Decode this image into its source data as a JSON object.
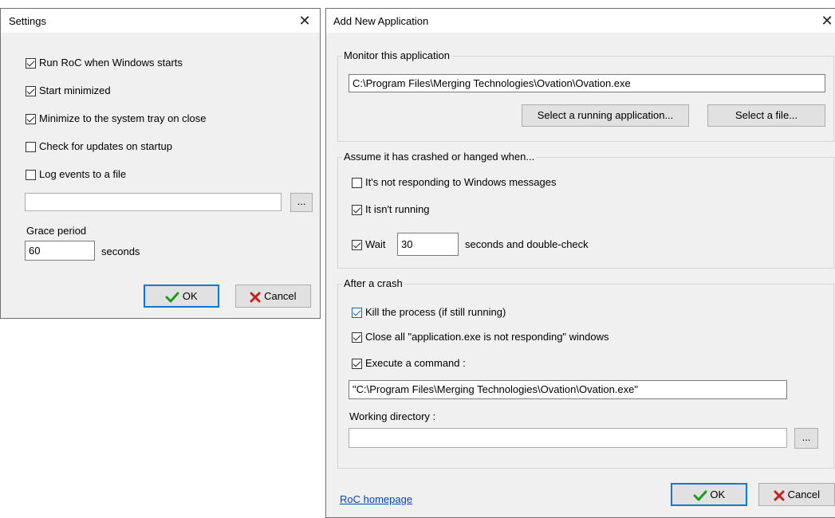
{
  "settings": {
    "title": "Settings",
    "options": [
      {
        "label": "Run RoC when Windows starts",
        "checked": true
      },
      {
        "label": "Start minimized",
        "checked": true
      },
      {
        "label": "Minimize to the system tray on close",
        "checked": true
      },
      {
        "label": "Check for updates on startup",
        "checked": false
      },
      {
        "label": "Log events to a file",
        "checked": false
      }
    ],
    "log_path": "",
    "browse_label": "...",
    "grace_label": "Grace period",
    "grace_value": "60",
    "grace_unit": "seconds",
    "ok_label": "OK",
    "cancel_label": "Cancel"
  },
  "add_app": {
    "title": "Add New Application",
    "monitor": {
      "group_label": "Monitor this application",
      "path": "C:\\Program Files\\Merging Technologies\\Ovation\\Ovation.exe",
      "select_running_label": "Select a running application...",
      "select_file_label": "Select a file..."
    },
    "crash": {
      "group_label": "Assume it has crashed or hanged when...",
      "not_responding_label": "It's not responding to Windows messages",
      "not_responding_checked": false,
      "not_running_label": "It isn't running",
      "not_running_checked": true,
      "wait_label": "Wait",
      "wait_checked": true,
      "wait_value": "30",
      "wait_suffix": "seconds and double-check"
    },
    "after": {
      "group_label": "After a crash",
      "kill_label": "Kill the process (if still running)",
      "kill_checked": true,
      "close_label": "Close all \"application.exe is not responding\" windows",
      "close_checked": true,
      "exec_label": "Execute a command :",
      "exec_checked": true,
      "command": "\"C:\\Program Files\\Merging Technologies\\Ovation\\Ovation.exe\"",
      "workdir_label": "Working directory :",
      "workdir_value": "",
      "browse_label": "..."
    },
    "homepage_link": "RoC homepage",
    "ok_label": "OK",
    "cancel_label": "Cancel"
  },
  "colors": {
    "ok_check": "#1e9b1e",
    "cancel_x": "#c81e1e",
    "accent": "#0078d7"
  }
}
